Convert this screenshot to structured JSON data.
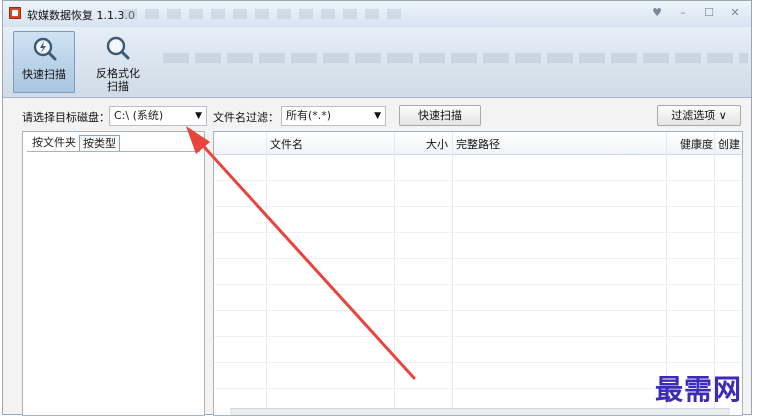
{
  "window": {
    "title": "软媒数据恢复 1.1.3.0",
    "controls": {
      "skin": "♥",
      "minimize": "–",
      "maximize": "☐",
      "close": "✕"
    }
  },
  "toolbar": {
    "buttons": [
      {
        "label": "快速扫描",
        "icon": "lightning-magnifier-icon",
        "active": true
      },
      {
        "label_line1": "反格式化",
        "label_line2": "扫描",
        "icon": "magnifier-icon",
        "active": false
      }
    ]
  },
  "filters": {
    "target_disk_label": "请选择目标磁盘：",
    "target_disk_value": "C:\\ (系统)",
    "filename_filter_label": "文件名过滤：",
    "filename_filter_value": "所有(*.*)",
    "quick_scan_button": "快速扫描",
    "filter_options_button": "过滤选项 ∨"
  },
  "left_panel": {
    "tabs": [
      {
        "label": "按文件夹",
        "selected": true
      },
      {
        "label": "按类型",
        "selected": false
      }
    ]
  },
  "file_table": {
    "columns": [
      "文件名",
      "大小",
      "完整路径",
      "健康度",
      "创建"
    ],
    "rows": []
  },
  "watermark": "最需网",
  "colors": {
    "accent": "#a9c6e0",
    "annotation_arrow": "#e8433c",
    "watermark": "#3b2bb5"
  }
}
